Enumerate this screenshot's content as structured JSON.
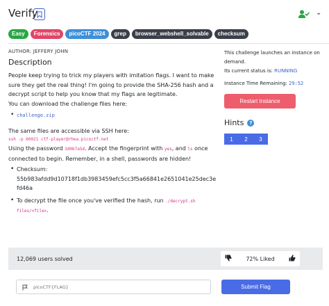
{
  "header": {
    "title": "Verify",
    "bookmark_icon": "bookmark-icon",
    "solved_icon": "user-check-icon",
    "menu_icon": "chevron-down-icon"
  },
  "tags": [
    {
      "label": "Easy",
      "color": "#28a745"
    },
    {
      "label": "Forensics",
      "color": "#e04667"
    },
    {
      "label": "picoCTF 2024",
      "color": "#3d8fd8"
    },
    {
      "label": "grep",
      "color": "#3a3f4a"
    },
    {
      "label": "browser_webshell_solvable",
      "color": "#3a3f4a"
    },
    {
      "label": "checksum",
      "color": "#3a3f4a"
    }
  ],
  "challenge": {
    "author": "AUTHOR: JEFFERY JOHN",
    "description_heading": "Description",
    "intro": "People keep trying to trick my players with imitation flags. I want to make sure they get the real thing! I'm going to provide the SHA-256 hash and a decrypt script to help you know that my flags are legitimate.",
    "download_text": "You can download the challenge files here:",
    "bullet_download": "challenge.zip",
    "ssh_text": "The same files are accessible via SSH here:",
    "ssh_command": "ssh -p 60021 ctf-player@rhea.picoctf.net",
    "pw_pre": "Using the password ",
    "pw": "3d0b7a5d",
    "pw_mid": ". Accept the fingerprint with ",
    "yes": "yes",
    "pw_and": ", and ",
    "ls": "ls",
    "pw_post": " once connected to begin. Remember, in a shell, passwords are hidden!",
    "checksum_label": "Checksum:",
    "checksum_value": "55b983afdd9d10718f1db3983459efc5cc3f5a66841e2651041e25dec3efd46a",
    "decrypt_pre": "To decrypt the file once you've verified the hash, run ",
    "decrypt_cmd": "./decrypt.sh files/<file>",
    "decrypt_post": "."
  },
  "instance": {
    "launch_text": "This challenge launches an instance on demand.",
    "status_label": "Its current status is: ",
    "status_value": "RUNNING",
    "time_label": "Instance Time Remaining: ",
    "time_value": "29:52",
    "restart_label": "Restart Instance"
  },
  "hints": {
    "title": "Hints",
    "help_icon": "question-icon",
    "buttons": [
      "1",
      "2",
      "3"
    ]
  },
  "stats": {
    "solved": "12,069 users solved",
    "liked": "72% Liked",
    "dislike_icon": "thumbs-down-icon",
    "like_icon": "thumbs-up-icon"
  },
  "flag": {
    "placeholder": "picoCTF{FLAG}",
    "flag_icon": "flag-icon",
    "submit_label": "Submit Flag"
  },
  "colors": {
    "accent": "#4a6be6",
    "restart": "#ee5d6c",
    "code": "#d63384",
    "link": "#3d63c8"
  }
}
